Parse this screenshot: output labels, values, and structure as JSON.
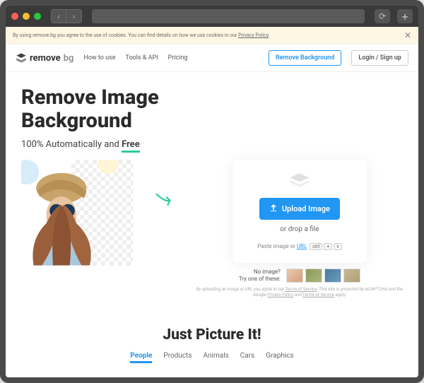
{
  "cookie": {
    "text_prefix": "By using remove.bg you agree to the use of cookies. You can find details on how we use cookies in our ",
    "link": "Privacy Policy",
    "text_suffix": "."
  },
  "logo": {
    "brand": "remove",
    "suffix": "bg"
  },
  "nav": {
    "how": "How to use",
    "tools": "Tools & API",
    "pricing": "Pricing"
  },
  "cta": {
    "remove": "Remove Background",
    "login": "Login / Sign up"
  },
  "hero": {
    "title_line1": "Remove Image",
    "title_line2": "Background",
    "subtitle_prefix": "100% Automatically and ",
    "subtitle_free": "Free"
  },
  "upload": {
    "button": "Upload Image",
    "drop": "or drop a file",
    "paste_prefix": "Paste image or ",
    "paste_url": "URL",
    "kbd1": "ctrl",
    "kbd2": "+",
    "kbd3": "v"
  },
  "samples": {
    "line1": "No image?",
    "line2": "Try one of these:"
  },
  "legal": {
    "prefix": "By uploading an image or URL you agree to our ",
    "tos": "Terms of Service",
    "mid": ". This site is protected by reCAPTCHA and the Google ",
    "pp": "Privacy Policy",
    "and": " and ",
    "tos2": "Terms of Service",
    "suffix": " apply."
  },
  "section2": {
    "title": "Just Picture It!"
  },
  "tabs": {
    "people": "People",
    "products": "Products",
    "animals": "Animals",
    "cars": "Cars",
    "graphics": "Graphics"
  }
}
